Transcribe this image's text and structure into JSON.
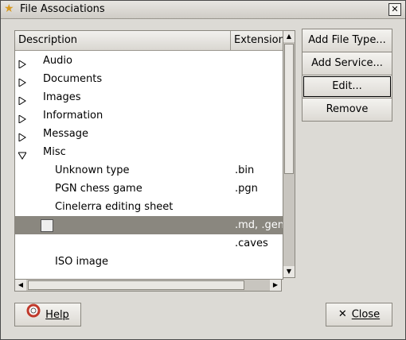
{
  "window": {
    "title": "File Associations",
    "close_glyph": "✕",
    "title_icon": "star-icon"
  },
  "list": {
    "columns": [
      "Description",
      "Extension"
    ],
    "rows": [
      {
        "desc": "Audio",
        "ext": "",
        "expander": "collapsed",
        "indent": 0
      },
      {
        "desc": "Documents",
        "ext": "",
        "expander": "collapsed",
        "indent": 0
      },
      {
        "desc": "Images",
        "ext": "",
        "expander": "collapsed",
        "indent": 0
      },
      {
        "desc": "Information",
        "ext": "",
        "expander": "collapsed",
        "indent": 0
      },
      {
        "desc": "Message",
        "ext": "",
        "expander": "collapsed",
        "indent": 0
      },
      {
        "desc": "Misc",
        "ext": "",
        "expander": "expanded",
        "indent": 0
      },
      {
        "desc": "Unknown type",
        "ext": ".bin",
        "expander": "none",
        "indent": 1
      },
      {
        "desc": "PGN chess game",
        "ext": ".pgn",
        "expander": "none",
        "indent": 1
      },
      {
        "desc": "Cinelerra editing sheet",
        "ext": "",
        "expander": "none",
        "indent": 1
      },
      {
        "desc": "",
        "ext": ".md, .gen",
        "expander": "none",
        "indent": 1,
        "selected": true,
        "icon": "file-icon"
      },
      {
        "desc": "",
        "ext": ".caves",
        "expander": "none",
        "indent": 1
      },
      {
        "desc": "ISO image",
        "ext": "",
        "expander": "none",
        "indent": 1
      }
    ]
  },
  "buttons": {
    "add_file_type": "Add File Type...",
    "add_service": "Add Service...",
    "edit": "Edit...",
    "remove": "Remove",
    "help": "Help",
    "close": "Close"
  },
  "colors": {
    "selected_row": "#8a877f",
    "dialog_bg": "#dcdad5"
  }
}
